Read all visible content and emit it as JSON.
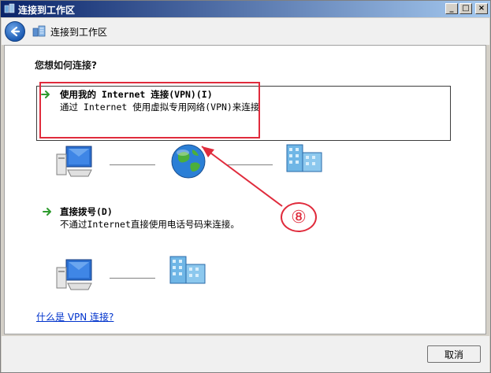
{
  "window": {
    "title": "连接到工作区",
    "min_glyph": "_",
    "max_glyph": "□",
    "close_glyph": "×"
  },
  "nav": {
    "title": "连接到工作区"
  },
  "main": {
    "question": "您想如何连接?",
    "options": [
      {
        "title": "使用我的 Internet 连接(VPN)(I)",
        "description": "通过 Internet 使用虚拟专用网络(VPN)来连接"
      },
      {
        "title": "直接拨号(D)",
        "description": "不通过Internet直接使用电话号码来连接。"
      }
    ],
    "help_link": "什么是 VPN 连接?",
    "annotation_number": "⑧"
  },
  "footer": {
    "cancel_label": "取消"
  },
  "colors": {
    "annotation": "#e02b3c",
    "link": "#0033cc",
    "titlebar_start": "#0a246a",
    "titlebar_end": "#a6caf0"
  }
}
